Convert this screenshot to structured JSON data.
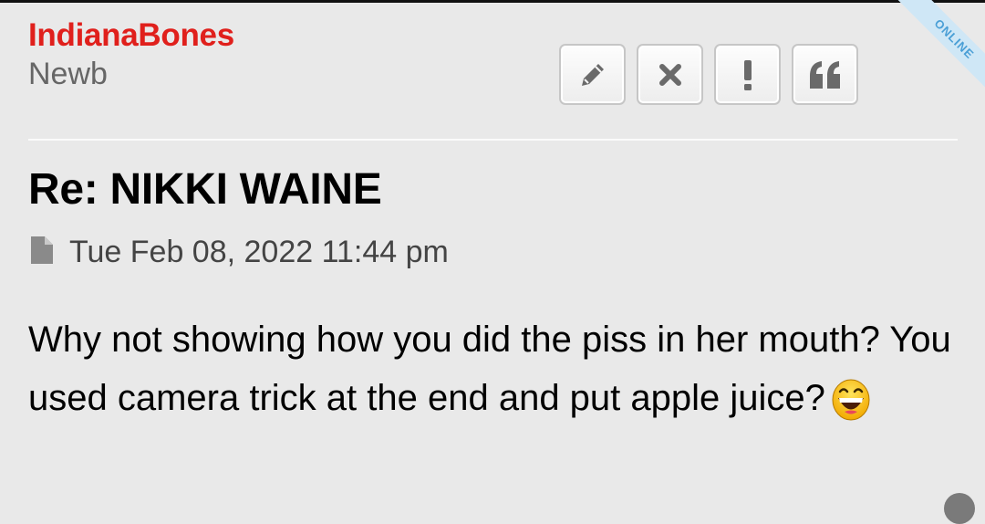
{
  "post": {
    "author": "IndianaBones",
    "rank": "Newb",
    "status_ribbon": "ONLINE",
    "title": "Re: NIKKI WAINE",
    "timestamp": "Tue Feb 08, 2022 11:44 pm",
    "body": "Why not showing how you did the piss in her mouth? You used camera trick at the end and put apple juice?",
    "emoji": "grinning-face-with-big-eyes"
  },
  "actions": [
    {
      "name": "edit",
      "icon": "pencil-icon"
    },
    {
      "name": "delete",
      "icon": "close-icon"
    },
    {
      "name": "report",
      "icon": "exclamation-icon"
    },
    {
      "name": "quote",
      "icon": "quote-icon"
    }
  ],
  "colors": {
    "author": "#e0201c",
    "ribbon_bg": "#cfe7f6",
    "ribbon_text": "#4a9fd6",
    "background": "#e9e9e9"
  }
}
